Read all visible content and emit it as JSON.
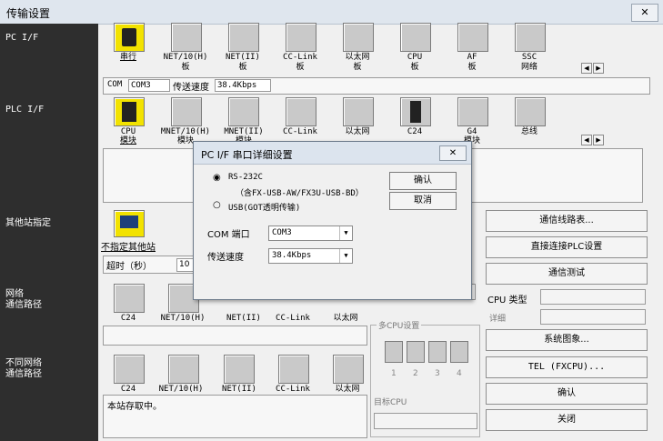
{
  "window": {
    "title": "传输设置",
    "close_label": "✕"
  },
  "sidebar": {
    "pc_if": "PC I/F",
    "plc_if": "PLC I/F",
    "other_station": "其他站指定",
    "network_route": [
      "网络",
      "通信路径"
    ],
    "diff_network_route": [
      "不同网络",
      "通信路径"
    ]
  },
  "pc_if": {
    "items": [
      {
        "label": [
          "串行"
        ],
        "selected": true
      },
      {
        "label": [
          "NET/10(H)",
          "板"
        ]
      },
      {
        "label": [
          "NET(II)",
          "板"
        ]
      },
      {
        "label": [
          "CC-Link",
          "板"
        ]
      },
      {
        "label": [
          "以太网",
          "板"
        ]
      },
      {
        "label": [
          "CPU",
          "板"
        ]
      },
      {
        "label": [
          "AF",
          "板"
        ]
      },
      {
        "label": [
          "SSC",
          "网络"
        ]
      }
    ],
    "status": {
      "com_label": "COM",
      "com_value": "COM3",
      "speed_label": "传送速度",
      "speed_value": "38.4Kbps"
    }
  },
  "plc_if": {
    "items": [
      {
        "label": [
          "CPU",
          "模块"
        ],
        "selected": true
      },
      {
        "label": [
          "MNET/10(H)",
          "模块"
        ]
      },
      {
        "label": [
          "MNET(II)",
          "模块"
        ]
      },
      {
        "label": [
          "CC-Link",
          "模块"
        ]
      },
      {
        "label": [
          "以太网",
          "模块"
        ]
      },
      {
        "label": [
          "C24"
        ]
      },
      {
        "label": [
          "G4",
          "模块"
        ]
      },
      {
        "label": [
          "总线"
        ]
      }
    ]
  },
  "other_station": {
    "label": "不指定其他站",
    "timeout_label": "超时（秒）",
    "timeout_value": "10"
  },
  "network_route": {
    "items": [
      "C24",
      "NET/10(H)",
      "NET(II)",
      "CC-Link",
      "以太网"
    ]
  },
  "diff_network_route": {
    "items": [
      "C24",
      "NET/10(H)",
      "NET(II)",
      "CC-Link",
      "以太网"
    ],
    "status_text": "本站存取中。"
  },
  "multi_cpu": {
    "label": "多CPU设置",
    "numbers": [
      "1",
      "2",
      "3",
      "4"
    ],
    "target_label": "目标CPU"
  },
  "right_panel": {
    "buttons": [
      "通信线路表...",
      "直接连接PLC设置",
      "通信测试"
    ],
    "cpu_type_label": "CPU 类型",
    "detail_label": "详细",
    "buttons2": [
      "系统图象...",
      "TEL (FXCPU)...",
      "确认",
      "关闭"
    ]
  },
  "dialog": {
    "title": "PC I/F 串口详细设置",
    "close_label": "✕",
    "radio_rs232c": "RS-232C",
    "rs232c_note": "（含FX-USB-AW/FX3U-USB-BD）",
    "radio_usb": "USB(GOT透明传输)",
    "com_port_label": "COM 端口",
    "com_port_value": "COM3",
    "speed_label": "传送速度",
    "speed_value": "38.4Kbps",
    "ok_label": "确认",
    "cancel_label": "取消"
  },
  "colors": {
    "sidebar": "#2e2e2e",
    "selected_icon": "#f2e200",
    "titlebar": "#dfe6ee"
  }
}
